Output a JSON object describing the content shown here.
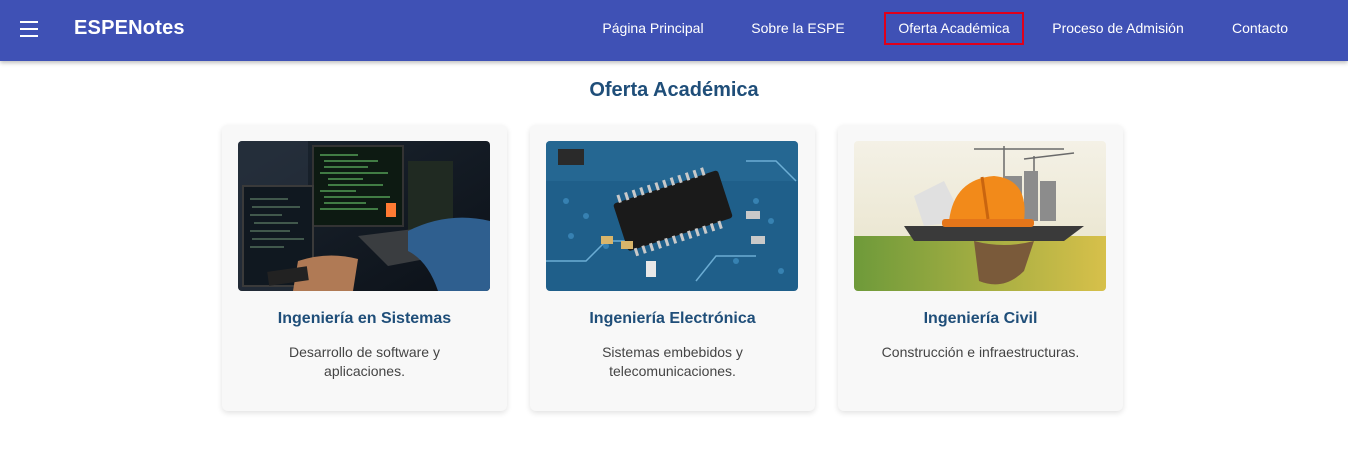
{
  "header": {
    "brand": "ESPENotes",
    "menu_icon": "hamburger-menu-icon",
    "nav": [
      {
        "label": "Página Principal"
      },
      {
        "label": "Sobre la ESPE"
      },
      {
        "label": "Oferta Académica",
        "active": true
      },
      {
        "label": "Proceso de Admisión"
      },
      {
        "label": "Contacto"
      }
    ],
    "color": "#3f51b5",
    "active_outline_color": "#e0001b"
  },
  "main": {
    "title": "Oferta Académica",
    "cards": [
      {
        "title": "Ingeniería en Sistemas",
        "description": "Desarrollo de software y aplicaciones.",
        "image": "programmer-coding-photo"
      },
      {
        "title": "Ingeniería Electrónica",
        "description": "Sistemas embebidos y telecomunicaciones.",
        "image": "circuit-board-chip-photo"
      },
      {
        "title": "Ingeniería Civil",
        "description": "Construcción e infraestructuras.",
        "image": "hardhat-construction-photo"
      }
    ]
  }
}
